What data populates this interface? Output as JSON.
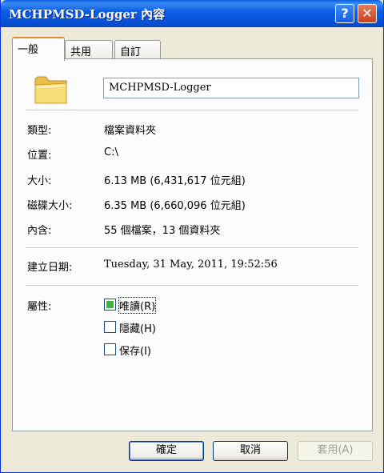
{
  "window": {
    "title": "MCHPMSD-Logger 內容",
    "help_label": "?",
    "close_label": "✕"
  },
  "tabs": [
    {
      "label": "一般"
    },
    {
      "label": "共用"
    },
    {
      "label": "自訂"
    }
  ],
  "general": {
    "name": "MCHPMSD-Logger",
    "type_label": "類型:",
    "type_value": "檔案資料夾",
    "location_label": "位置:",
    "location_value": "C:\\",
    "size_label": "大小:",
    "size_value": "6.13 MB (6,431,617 位元組)",
    "disk_size_label": "磁碟大小:",
    "disk_size_value": "6.35 MB (6,660,096 位元組)",
    "contains_label": "內含:",
    "contains_value": "55 個檔案，13 個資料夾",
    "created_label": "建立日期:",
    "created_value": "Tuesday, 31 May, 2011, 19:52:56",
    "attributes_label": "屬性:",
    "attributes": [
      {
        "label": "唯讀(R)",
        "checked": "partial"
      },
      {
        "label": "隱藏(H)",
        "checked": false
      },
      {
        "label": "保存(I)",
        "checked": false
      }
    ]
  },
  "buttons": {
    "ok": "確定",
    "cancel": "取消",
    "apply": "套用(A)"
  },
  "icons": {
    "folder": "folder-icon",
    "help": "help-icon",
    "close": "close-icon"
  }
}
